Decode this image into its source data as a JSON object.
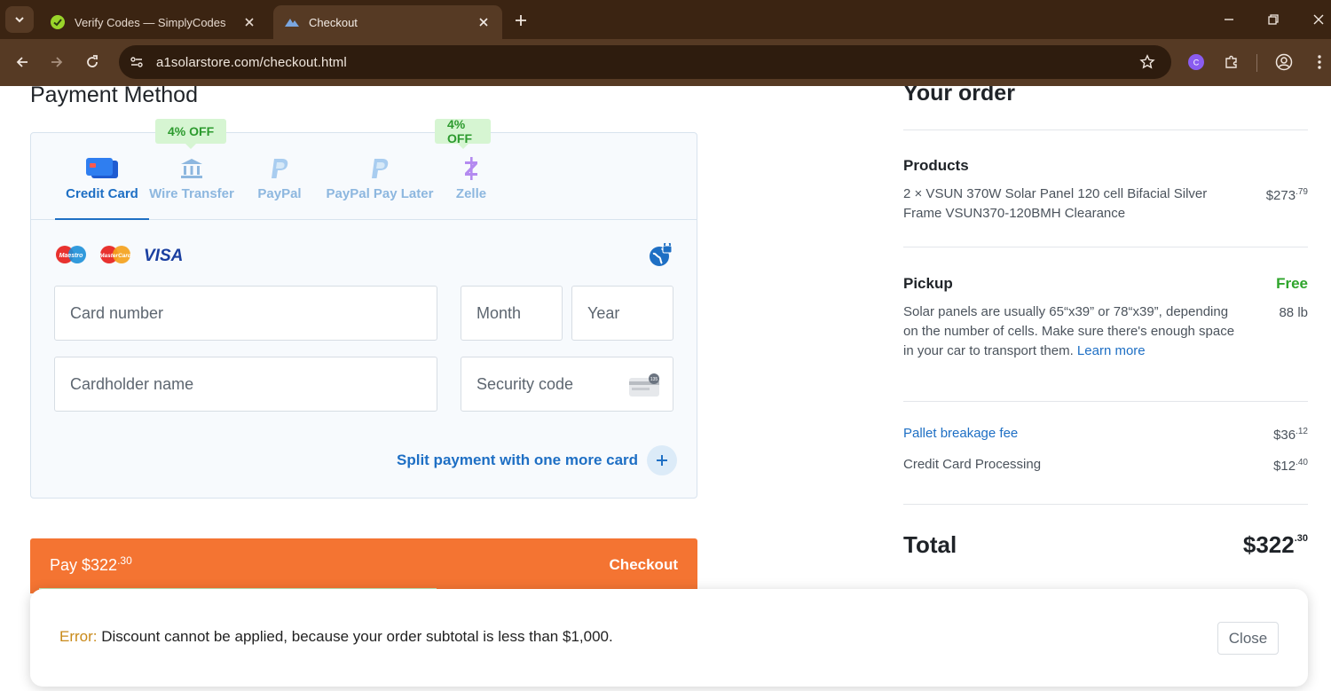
{
  "browser": {
    "tabs": [
      {
        "title": "Verify Codes — SimplyCodes",
        "active": false
      },
      {
        "title": "Checkout",
        "active": true
      }
    ],
    "url": "a1solarstore.com/checkout.html"
  },
  "payment": {
    "title": "Payment Method",
    "methods": [
      {
        "label": "Credit Card",
        "icon": "credit-card-icon",
        "selected": true
      },
      {
        "label": "Wire Transfer",
        "icon": "bank-icon",
        "badge": "4% OFF"
      },
      {
        "label": "PayPal",
        "icon": "paypal-icon"
      },
      {
        "label": "PayPal Pay Later",
        "icon": "paypal-icon"
      },
      {
        "label": "Zelle",
        "icon": "zelle-icon",
        "badge": "4% OFF"
      }
    ],
    "card_brands": [
      "Maestro",
      "MasterCard",
      "VISA"
    ],
    "fields": {
      "card_number": "Card number",
      "month": "Month",
      "year": "Year",
      "cardholder": "Cardholder name",
      "security_code": "Security code",
      "cvv_hint": "135"
    },
    "split_label": "Split payment with one more card",
    "pay_label": "Pay $322",
    "pay_cents": ".30",
    "checkout_label": "Checkout",
    "accent": "#f47432",
    "link_color": "#1e6fc4"
  },
  "order": {
    "title": "Your order",
    "products_label": "Products",
    "product_line1": "2 × VSUN 370W Solar Panel 120 cell Bifacial Silver",
    "product_line2": "Frame VSUN370-120BMH Clearance",
    "product_price": "$273",
    "product_cents": ".79",
    "pickup_label": "Pickup",
    "pickup_price": "Free",
    "pickup_text_1": "Solar panels are usually 65“x39” or 78“x39”, depending",
    "pickup_text_2": "on the number of cells. Make sure there's enough space",
    "pickup_text_3": "in your car to transport them.",
    "learn_more": "Learn more",
    "weight": "88 lb",
    "pallet_label": "Pallet breakage fee",
    "pallet_price": "$36",
    "pallet_cents": ".12",
    "cc_label": "Credit Card Processing",
    "cc_price": "$12",
    "cc_cents": ".40",
    "total_label": "Total",
    "total_value": "$322",
    "total_cents": ".30"
  },
  "toast": {
    "error_prefix": "Error:",
    "message": " Discount cannot be applied, because your order subtotal is less than $1,000.",
    "close_label": "Close"
  }
}
